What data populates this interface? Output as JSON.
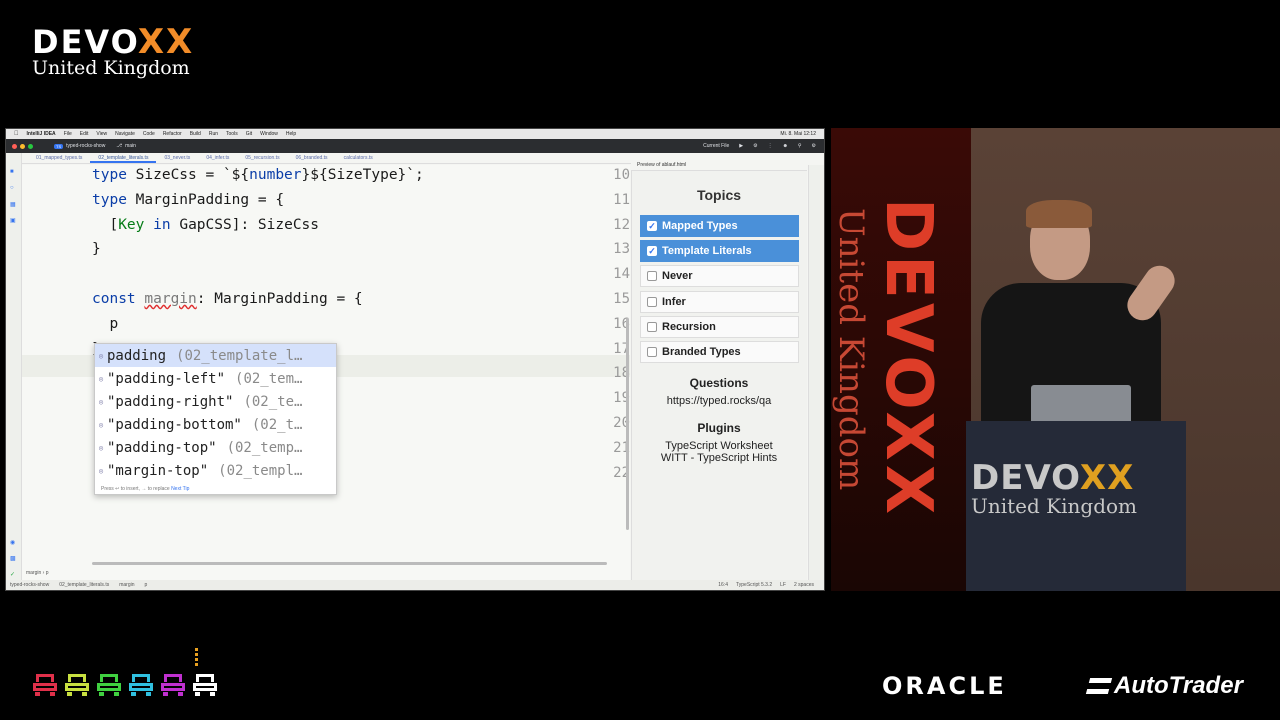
{
  "event": {
    "word": "DEVO",
    "word_xx": "XX",
    "subtitle": "United Kingdom"
  },
  "ide": {
    "mac_menu": [
      "IntelliJ IDEA",
      "File",
      "Edit",
      "View",
      "Navigate",
      "Code",
      "Refactor",
      "Build",
      "Run",
      "Tools",
      "Git",
      "Window",
      "Help"
    ],
    "clock": "Mi. 8. Mai 12:12",
    "project_badge": "TS",
    "project": "typed-rocks-show",
    "branch": "main",
    "run_config": "Current File",
    "tabs": [
      "01_mapped_types.ts",
      "02_template_literals.ts",
      "03_never.ts",
      "04_infer.ts",
      "05_recursion.ts",
      "06_branded.ts",
      "calculators.ts"
    ],
    "active_tab_index": 1,
    "code_lines": [
      {
        "n": "10",
        "html": "<span class=\"kw\">type</span> SizeCss = `${<span class=\"kw\">number</span>}${SizeType}`;"
      },
      {
        "n": "11",
        "html": "<span class=\"kw\">type</span> MarginPadding = {"
      },
      {
        "n": "12",
        "html": "  [<span class=\"str\">Key</span> <span class=\"kw\">in</span> GapCSS]: SizeCss"
      },
      {
        "n": "13",
        "html": "}"
      },
      {
        "n": "14",
        "html": ""
      },
      {
        "n": "15",
        "html": "<span class=\"kw\">const</span> <span class=\"err\">margin</span>: MarginPadding = {"
      },
      {
        "n": "16",
        "html": "  p"
      },
      {
        "n": "17",
        "html": "}"
      },
      {
        "n": "18",
        "html": ""
      },
      {
        "n": "19",
        "html": ""
      },
      {
        "n": "20",
        "html": ""
      },
      {
        "n": "21",
        "html": ""
      },
      {
        "n": "22",
        "html": ""
      }
    ],
    "completion": {
      "items": [
        {
          "label": "padding",
          "source": "(02_template_l…"
        },
        {
          "label": "\"padding-left\"",
          "source": "(02_tem…"
        },
        {
          "label": "\"padding-right\"",
          "source": "(02_te…"
        },
        {
          "label": "\"padding-bottom\"",
          "source": "(02_t…"
        },
        {
          "label": "\"padding-top\"",
          "source": "(02_temp…"
        },
        {
          "label": "\"margin-top\"",
          "source": "(02_templ…"
        }
      ],
      "selected_index": 0,
      "hint": "Press ↩ to insert, → to replace",
      "hint_link": "Next Tip"
    },
    "breadcrumb": "margin  ›  p",
    "status": {
      "path": [
        "typed-rocks-show",
        "02_template_literals.ts",
        "margin",
        "p"
      ],
      "position": "16:4",
      "language": "TypeScript 5.3.2",
      "line_sep": "LF",
      "indent": "2 spaces"
    }
  },
  "preview": {
    "tab_label": "Preview of ablauf.html",
    "topics_title": "Topics",
    "topics": [
      {
        "label": "Mapped Types",
        "checked": true
      },
      {
        "label": "Template Literals",
        "checked": true
      },
      {
        "label": "Never",
        "checked": false
      },
      {
        "label": "Infer",
        "checked": false
      },
      {
        "label": "Recursion",
        "checked": false
      },
      {
        "label": "Branded Types",
        "checked": false
      }
    ],
    "questions_title": "Questions",
    "questions_url": "https://typed.rocks/qa",
    "plugins_title": "Plugins",
    "plugins": [
      "TypeScript Worksheet",
      "WITT - TypeScript Hints"
    ]
  },
  "stage": {
    "banner_word": "DEVOXX",
    "banner_sub": "United Kingdom",
    "podium_word": "DEVO",
    "podium_xx": "XX",
    "podium_sub": "United Kingdom"
  },
  "sponsors": {
    "oracle": "ORACLE",
    "autotrader": "AutoTrader",
    "pixel_colors": [
      "#e0304a",
      "#c8e040",
      "#40d040",
      "#30c0e0",
      "#c030d0",
      "#ffffff"
    ]
  }
}
